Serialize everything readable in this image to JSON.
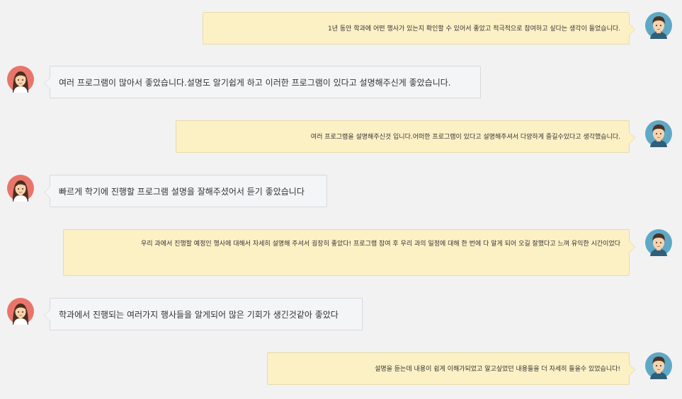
{
  "colors": {
    "background": "#f2f2f3",
    "sent_bubble": "#fcf0c5",
    "received_bubble": "#f4f5f7",
    "male_avatar_bg": "#5fa8c5",
    "female_avatar_bg": "#e9756a"
  },
  "messages": [
    {
      "side": "right",
      "avatar": "male-avatar-icon",
      "text": "1년 동안 학과에 어떤 행사가 있는지 확인할 수 있어서 좋았고 적극적으로 참여하고 싶다는 생각이 들었습니다."
    },
    {
      "side": "left",
      "avatar": "female-avatar-icon",
      "text": "여러 프로그램이 많아서 좋았습니다.설명도 알기쉽게 하고 이러한 프로그램이 있다고 설명해주신게 좋았습니다."
    },
    {
      "side": "right",
      "avatar": "male-avatar-icon",
      "text": "여러 프로그램을 설명해주신것 입니다.어떠한 프로그램이 있다고 설명해주셔서 다양하게 즐길수있다고 생각했습니다."
    },
    {
      "side": "left",
      "avatar": "female-avatar-icon",
      "text": "빠르게 학기에 진행할 프로그램 설명을 잘해주셨어서 듣기 좋았습니다"
    },
    {
      "side": "right",
      "avatar": "male-avatar-icon",
      "text": "우리 과에서 진행할 예정인 행사에 대해서 자세히 설명해 주셔서 굉장히 좋았다! 프로그램 참여 후 우리 과의 일정에 대해 한 번에 다 알게 되어 오길 잘했다고 느껴 유익한 시간이었다"
    },
    {
      "side": "left",
      "avatar": "female-avatar-icon",
      "text": "학과에서 진행되는 여러가지 행사들을 알게되어 많은 기회가 생긴것같아 좋았다"
    },
    {
      "side": "right",
      "avatar": "male-avatar-icon",
      "text": "설명을 듣는데 내용이 쉽게 이해가되었고 알고싶었던 내용들을 더 자세히 들을수 있었습니다!"
    }
  ]
}
